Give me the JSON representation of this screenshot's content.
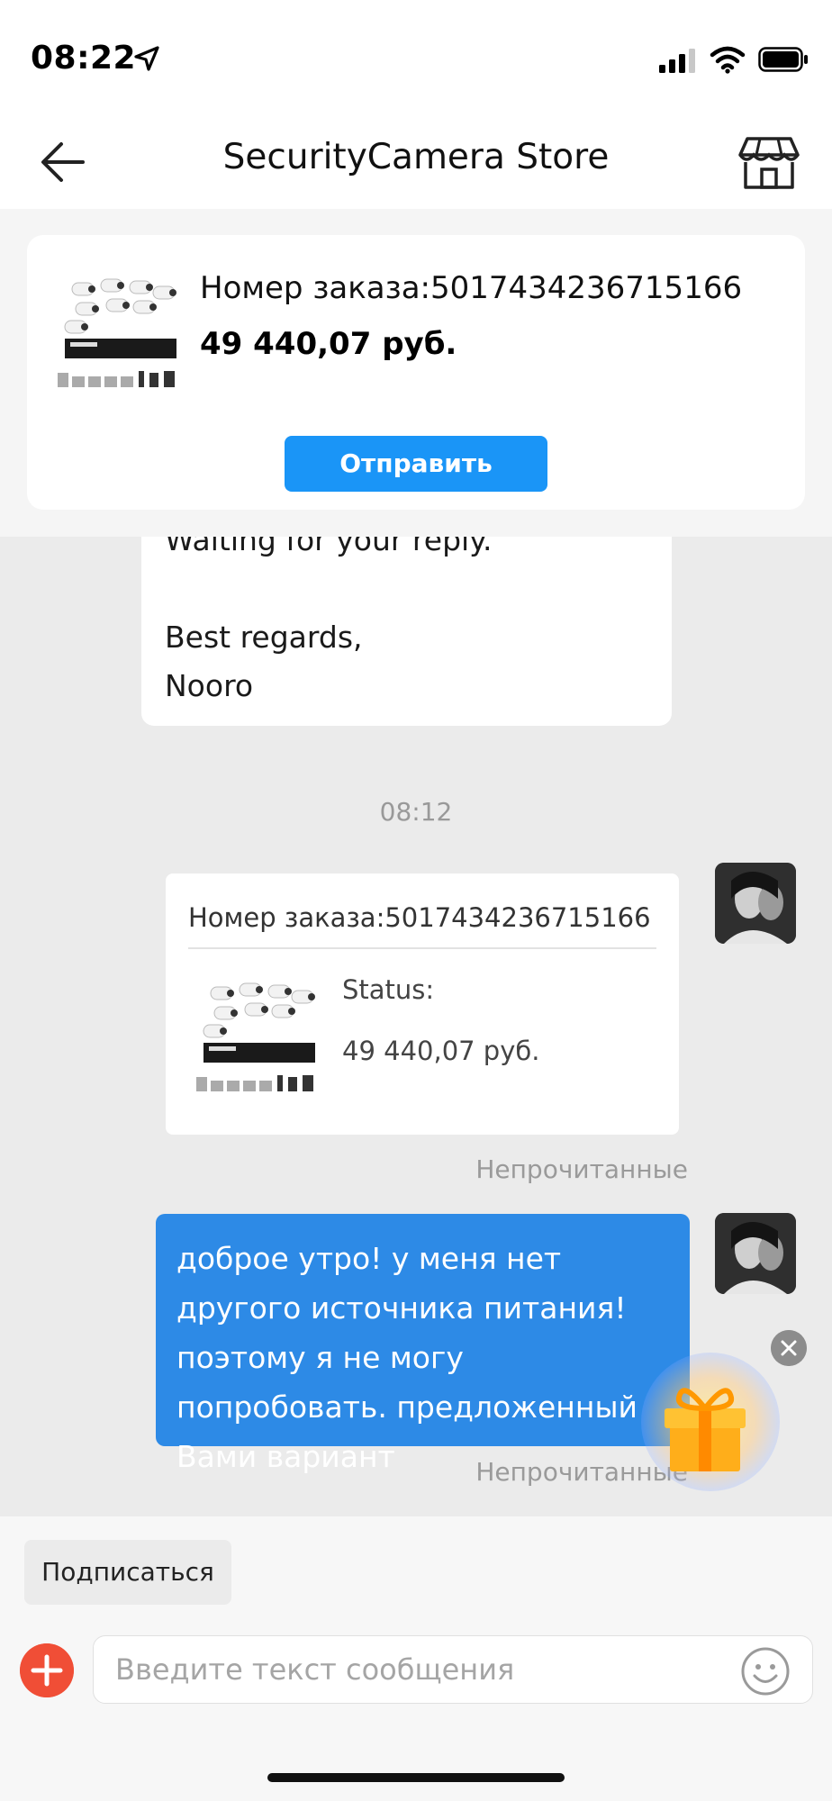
{
  "status_bar": {
    "time": "08:22"
  },
  "nav": {
    "title": "SecurityCamera Store"
  },
  "pinned_order": {
    "order_number": "Номер заказа:5017434236715166",
    "price": "49 440,07 руб.",
    "send_label": "Отправить"
  },
  "messages": {
    "incoming_lines": [
      "Waiting for your reply.",
      "",
      "Best regards,",
      "Nooro"
    ],
    "time_stamp": "08:12",
    "order_card": {
      "order_number": "Номер заказа:5017434236715166",
      "status": "Status:",
      "price": "49 440,07 руб.",
      "read_status": "Непрочитанные"
    },
    "outgoing": {
      "text": "доброе утро! у меня нет другого источника питания! поэтому я не могу попробовать. предложенный Вами вариант",
      "read_status": "Непрочитанные"
    }
  },
  "composer": {
    "subscribe_label": "Подписаться",
    "placeholder": "Введите текст сообщения"
  },
  "colors": {
    "accent_blue": "#1a95f7",
    "bubble_blue": "#2d8ae6",
    "plus_red": "#f04e36"
  },
  "icons": [
    "location-arrow-icon",
    "signal-icon",
    "wifi-icon",
    "battery-icon",
    "back-arrow-icon",
    "store-icon",
    "close-icon",
    "gift-icon",
    "plus-icon",
    "emoji-icon"
  ]
}
